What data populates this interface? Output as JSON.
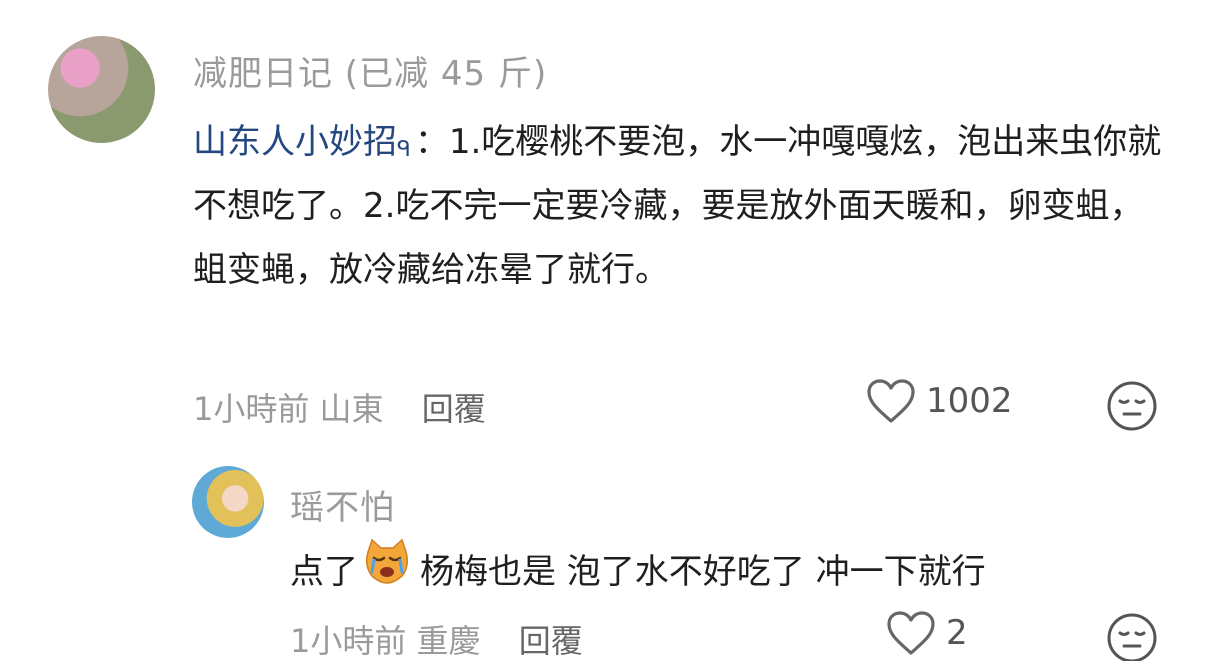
{
  "comment": {
    "username": "减肥日记 (已减 45 斤)",
    "mention": "山东人小妙招",
    "mention_icon": "search-icon",
    "text": "：1.吃樱桃不要泡，水一冲嘎嘎炫，泡出来虫你就不想吃了。2.吃不完一定要冷藏，要是放外面天暖和，卵变蛆，蛆变蝇，放冷藏给冻晕了就行。",
    "time": "1小時前",
    "location": "山東",
    "reply_label": "回覆",
    "likes": "1002"
  },
  "reply": {
    "username": "瑶不怕",
    "text_before_emoji": "点了",
    "emoji": "crying-cat-emoji",
    "text_after_emoji": "杨梅也是 泡了水不好吃了 冲一下就行",
    "time": "1小時前",
    "location": "重慶",
    "reply_label": "回覆",
    "likes": "2"
  },
  "colors": {
    "username": "#9a9a9a",
    "mention": "#24477f",
    "body_text": "#1f1f1f"
  }
}
